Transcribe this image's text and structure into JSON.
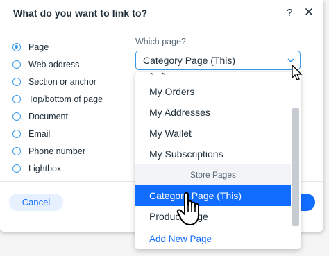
{
  "dialog": {
    "title": "What do you want to link to?",
    "help_label": "?"
  },
  "options": [
    {
      "label": "Page",
      "selected": true
    },
    {
      "label": "Web address",
      "selected": false
    },
    {
      "label": "Section or anchor",
      "selected": false
    },
    {
      "label": "Top/bottom of page",
      "selected": false
    },
    {
      "label": "Document",
      "selected": false
    },
    {
      "label": "Email",
      "selected": false
    },
    {
      "label": "Phone number",
      "selected": false
    },
    {
      "label": "Lightbox",
      "selected": false
    }
  ],
  "page_select": {
    "label": "Which page?",
    "value": "Category Page (This)"
  },
  "dropdown": {
    "items": [
      {
        "label": "My Orders"
      },
      {
        "label": "My Addresses"
      },
      {
        "label": "My Wallet"
      },
      {
        "label": "My Subscriptions"
      }
    ],
    "section_label": "Store Pages",
    "selected_item": "Category Page (This)",
    "next_item": "Product Page",
    "add_new_label": "Add New Page"
  },
  "footer": {
    "cancel_label": "Cancel"
  },
  "colors": {
    "accent": "#116dff",
    "radio": "#3899ec",
    "text": "#20303c"
  }
}
